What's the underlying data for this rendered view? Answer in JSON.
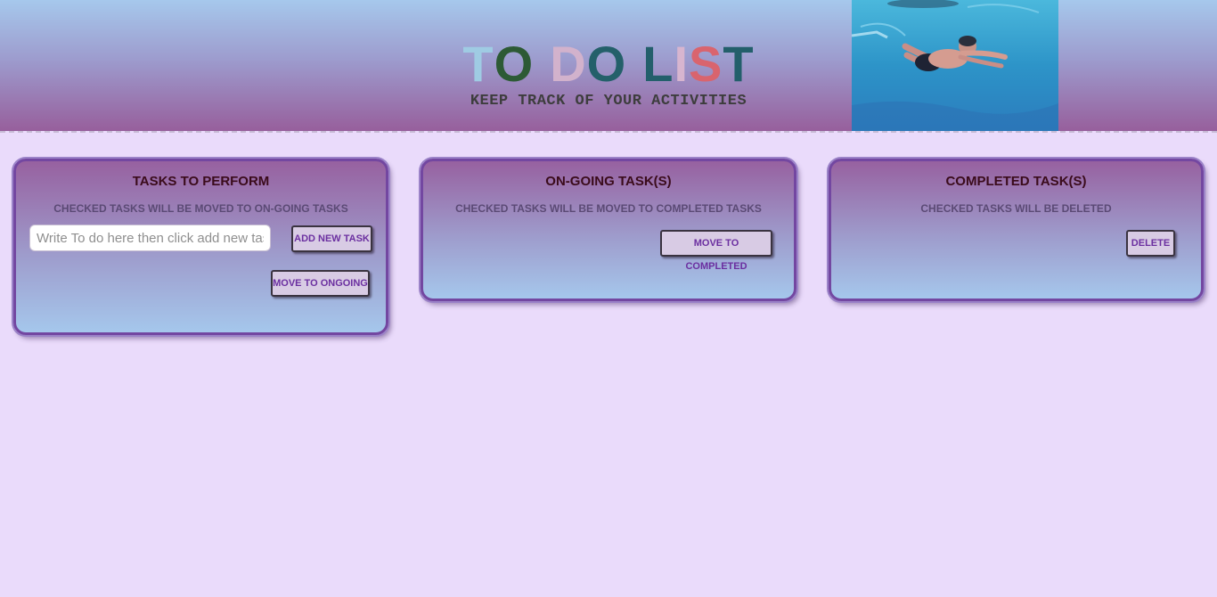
{
  "header": {
    "title_letters": [
      {
        "ch": "T",
        "color": "#9fcbe3"
      },
      {
        "ch": "O",
        "color": "#2d5a35"
      },
      {
        "ch": " ",
        "color": "#000000"
      },
      {
        "ch": "D",
        "color": "#d2b2cc"
      },
      {
        "ch": "O",
        "color": "#24606a"
      },
      {
        "ch": " ",
        "color": "#000000"
      },
      {
        "ch": "L",
        "color": "#235f6b"
      },
      {
        "ch": "I",
        "color": "#d7b5cf"
      },
      {
        "ch": "S",
        "color": "#d9646e"
      },
      {
        "ch": "T",
        "color": "#235f6b"
      }
    ],
    "subtitle": "KEEP TRACK OF YOUR ACTIVITIES",
    "image_icon": "swimmer-photo"
  },
  "panels": {
    "todo": {
      "title": "TASKS TO PERFORM",
      "hint": "CHECKED TASKS WILL BE MOVED TO ON-GOING TASKS",
      "input_placeholder": "Write To do here then click add new task",
      "input_value": "",
      "add_button": "ADD NEW TASK",
      "move_button": "MOVE TO ONGOING"
    },
    "ongoing": {
      "title": "ON-GOING TASK(S)",
      "hint": "CHECKED TASKS WILL BE MOVED TO COMPLETED TASKS",
      "move_button": "MOVE TO COMPLETED"
    },
    "completed": {
      "title": "COMPLETED TASK(S)",
      "hint": "CHECKED TASKS WILL BE DELETED",
      "delete_button": "DELETE"
    }
  },
  "colors": {
    "page_background": "#eadbfb",
    "panel_border": "#7347a1",
    "button_text": "#6b2fa0",
    "panel_title": "#3a0b1b"
  }
}
